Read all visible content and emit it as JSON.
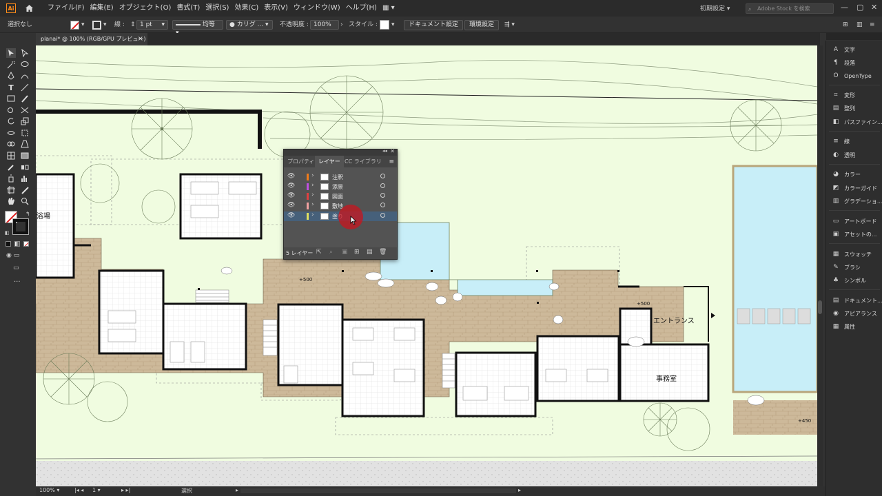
{
  "menubar": {
    "logo": "Ai",
    "items": [
      "ファイル(F)",
      "編集(E)",
      "オブジェクト(O)",
      "書式(T)",
      "選択(S)",
      "効果(C)",
      "表示(V)",
      "ウィンドウ(W)",
      "ヘルプ(H)"
    ],
    "workspace": "初期設定",
    "search_placeholder": "Adobe Stock を検索"
  },
  "controlbar": {
    "selection": "選択なし",
    "stroke_label": "線 :",
    "stroke_weight": "1 pt",
    "profile": "均等",
    "brush": "カリグ ...",
    "opacity_label": "不透明度 :",
    "opacity_value": "100%",
    "style_label": "スタイル :",
    "document_setup": "ドキュメント設定",
    "preferences": "環境設定"
  },
  "tab": {
    "title": "planai* @ 100% (RGB/GPU プレビュー)",
    "close": "×"
  },
  "plan": {
    "labels": {
      "bath": "浴場",
      "entrance": "エントランス",
      "office": "事務室",
      "level1": "+500",
      "level2": "+500",
      "level3": "+450"
    }
  },
  "layers_panel": {
    "tabs": [
      "プロパティ",
      "レイヤー",
      "CC ライブラリ"
    ],
    "active_tab": 1,
    "layers": [
      {
        "name": "注釈",
        "color": "#f07b1a",
        "selected": false
      },
      {
        "name": "添景",
        "color": "#c050e0",
        "selected": false
      },
      {
        "name": "図面",
        "color": "#e04040",
        "selected": false
      },
      {
        "name": "敷地",
        "color": "#f0a0a0",
        "selected": false
      },
      {
        "name": "塗り",
        "color": "#e0e060",
        "selected": true
      }
    ],
    "footer_count": "5 レイヤー"
  },
  "right_dock": {
    "items": [
      {
        "label": "文字",
        "icon": "A"
      },
      {
        "label": "段落",
        "icon": "¶"
      },
      {
        "label": "OpenType",
        "icon": "O"
      },
      {
        "label": "変形",
        "icon": "⌗"
      },
      {
        "label": "整列",
        "icon": "▤"
      },
      {
        "label": "パスファイン...",
        "icon": "◧"
      },
      {
        "label": "線",
        "icon": "≡"
      },
      {
        "label": "透明",
        "icon": "◐"
      },
      {
        "label": "カラー",
        "icon": "◕"
      },
      {
        "label": "カラーガイド",
        "icon": "◩"
      },
      {
        "label": "グラデーショ...",
        "icon": "▥"
      },
      {
        "label": "アートボード",
        "icon": "▭"
      },
      {
        "label": "アセットの...",
        "icon": "▣"
      },
      {
        "label": "スウォッチ",
        "icon": "▦"
      },
      {
        "label": "ブラシ",
        "icon": "✎"
      },
      {
        "label": "シンボル",
        "icon": "♣"
      },
      {
        "label": "ドキュメント...",
        "icon": "▤"
      },
      {
        "label": "アピアランス",
        "icon": "◉"
      },
      {
        "label": "属性",
        "icon": "▦"
      }
    ]
  },
  "statusbar": {
    "zoom": "100%",
    "artboard": "1",
    "tool": "選択"
  }
}
